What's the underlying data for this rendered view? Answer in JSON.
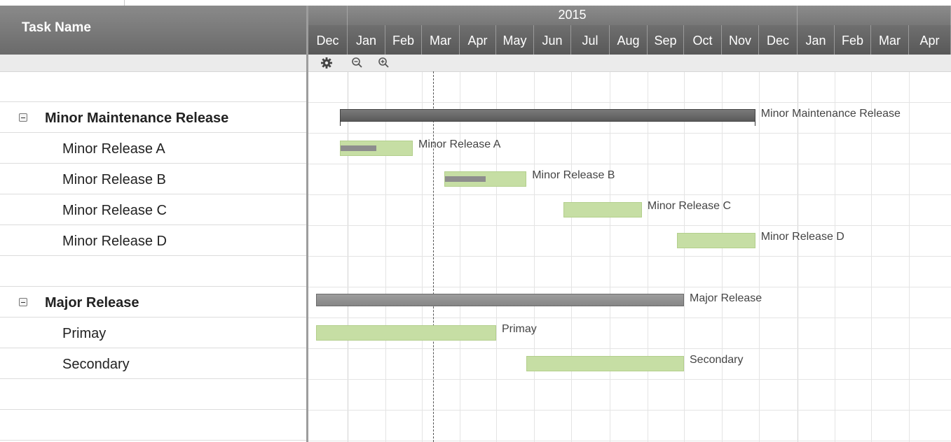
{
  "left": {
    "header": "Task Name",
    "rows": [
      {
        "label": "",
        "type": "blank"
      },
      {
        "label": "Minor Maintenance Release",
        "type": "group"
      },
      {
        "label": "Minor Release A",
        "type": "child"
      },
      {
        "label": "Minor Release B",
        "type": "child"
      },
      {
        "label": "Minor Release C",
        "type": "child"
      },
      {
        "label": "Minor Release D",
        "type": "child"
      },
      {
        "label": "",
        "type": "blank"
      },
      {
        "label": "Major Release",
        "type": "group"
      },
      {
        "label": "Primay",
        "type": "child"
      },
      {
        "label": "Secondary",
        "type": "child"
      },
      {
        "label": "",
        "type": "blank"
      },
      {
        "label": "",
        "type": "blank"
      }
    ]
  },
  "timeline": {
    "years": [
      {
        "label": "",
        "months": 1
      },
      {
        "label": "2015",
        "months": 12
      },
      {
        "label": "",
        "months": 4
      }
    ],
    "months": [
      "Dec",
      "Jan",
      "Feb",
      "Mar",
      "Apr",
      "May",
      "Jun",
      "Jul",
      "Aug",
      "Sep",
      "Oct",
      "Nov",
      "Dec",
      "Jan",
      "Feb",
      "Mar",
      "Apr"
    ],
    "toolbar_icons": [
      "gear-icon",
      "zoom-out-icon",
      "zoom-in-icon"
    ]
  },
  "bars": [
    {
      "row": 1,
      "kind": "summary",
      "label": "Minor Maintenance Release",
      "start": 0.8,
      "end": 11.9
    },
    {
      "row": 2,
      "kind": "task",
      "label": "Minor Release A",
      "start": 0.8,
      "end": 2.75,
      "progress": 0.5
    },
    {
      "row": 3,
      "kind": "task",
      "label": "Minor Release B",
      "start": 3.6,
      "end": 5.8,
      "progress": 0.5
    },
    {
      "row": 4,
      "kind": "task",
      "label": "Minor Release C",
      "start": 6.8,
      "end": 8.85,
      "progress": 0
    },
    {
      "row": 5,
      "kind": "task",
      "label": "Minor Release D",
      "start": 9.8,
      "end": 11.9,
      "progress": 0
    },
    {
      "row": 7,
      "kind": "summary-light",
      "label": "Major Release",
      "start": 0.2,
      "end": 10.0
    },
    {
      "row": 8,
      "kind": "task",
      "label": "Primay",
      "start": 0.2,
      "end": 5.0,
      "progress": 0
    },
    {
      "row": 9,
      "kind": "task",
      "label": "Secondary",
      "start": 5.8,
      "end": 10.0,
      "progress": 0
    }
  ],
  "today_marker": 3.3,
  "colors": {
    "header_dark": "#6a6a6a",
    "task_bar": "#c6dea4",
    "summary_bar": "#666666",
    "progress": "#8d8d8d"
  }
}
